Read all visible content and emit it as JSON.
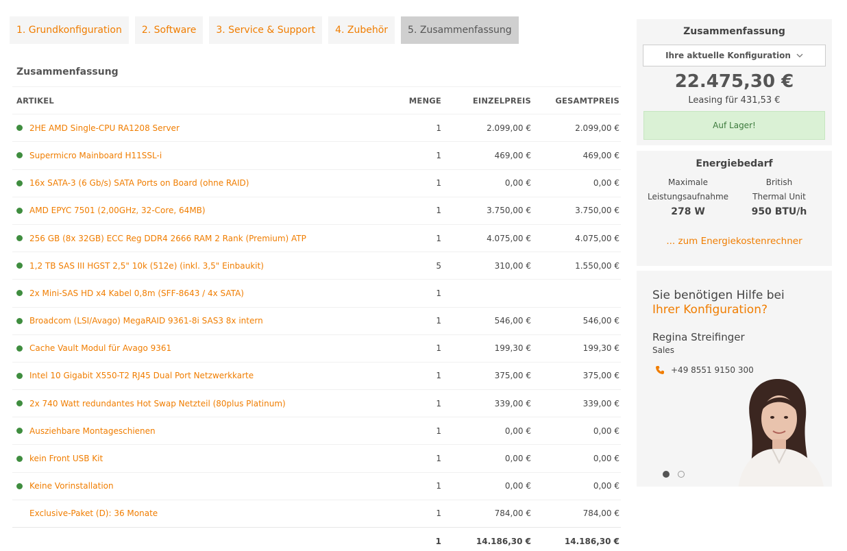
{
  "tabs": [
    {
      "label": "1. Grundkonfiguration"
    },
    {
      "label": "2. Software"
    },
    {
      "label": "3. Service & Support"
    },
    {
      "label": "4. Zubehör"
    },
    {
      "label": "5. Zusammenfassung"
    }
  ],
  "summary_title": "Zusammenfassung",
  "table": {
    "headers": {
      "article": "ARTIKEL",
      "qty": "MENGE",
      "unit": "EINZELPREIS",
      "total": "GESAMTPREIS"
    },
    "rows": [
      {
        "article": "2HE AMD Single-CPU RA1208 Server",
        "qty": "1",
        "unit": "2.099,00 €",
        "total": "2.099,00 €"
      },
      {
        "article": "Supermicro Mainboard H11SSL-i",
        "qty": "1",
        "unit": "469,00 €",
        "total": "469,00 €"
      },
      {
        "article": "16x SATA-3 (6 Gb/s) SATA Ports on Board (ohne RAID)",
        "qty": "1",
        "unit": "0,00 €",
        "total": "0,00 €"
      },
      {
        "article": "AMD EPYC 7501 (2,00GHz, 32-Core, 64MB)",
        "qty": "1",
        "unit": "3.750,00 €",
        "total": "3.750,00 €"
      },
      {
        "article": "256 GB (8x 32GB) ECC Reg DDR4 2666 RAM 2 Rank (Premium) ATP",
        "qty": "1",
        "unit": "4.075,00 €",
        "total": "4.075,00 €"
      },
      {
        "article": "1,2 TB SAS III HGST 2,5\" 10k (512e) (inkl. 3,5\" Einbaukit)",
        "qty": "5",
        "unit": "310,00 €",
        "total": "1.550,00 €"
      },
      {
        "article": "2x Mini-SAS HD x4 Kabel 0,8m (SFF-8643 / 4x SATA)",
        "qty": "1",
        "unit": "",
        "total": ""
      },
      {
        "article": "Broadcom (LSI/Avago) MegaRAID 9361-8i SAS3 8x intern",
        "qty": "1",
        "unit": "546,00 €",
        "total": "546,00 €"
      },
      {
        "article": "Cache Vault Modul für Avago 9361",
        "qty": "1",
        "unit": "199,30 €",
        "total": "199,30 €"
      },
      {
        "article": "Intel 10 Gigabit X550-T2 RJ45 Dual Port Netzwerkkarte",
        "qty": "1",
        "unit": "375,00 €",
        "total": "375,00 €"
      },
      {
        "article": "2x 740 Watt redundantes Hot Swap Netzteil (80plus Platinum)",
        "qty": "1",
        "unit": "339,00 €",
        "total": "339,00 €"
      },
      {
        "article": "Ausziehbare Montageschienen",
        "qty": "1",
        "unit": "0,00 €",
        "total": "0,00 €"
      },
      {
        "article": "kein Front USB Kit",
        "qty": "1",
        "unit": "0,00 €",
        "total": "0,00 €"
      },
      {
        "article": "Keine Vorinstallation",
        "qty": "1",
        "unit": "0,00 €",
        "total": "0,00 €"
      },
      {
        "article": "Exclusive-Paket (D): 36 Monate",
        "qty": "1",
        "unit": "784,00 €",
        "total": "784,00 €"
      }
    ],
    "sum": {
      "qty": "1",
      "unit": "14.186,30 €",
      "total": "14.186,30 €"
    }
  },
  "sidebar": {
    "summary": {
      "title": "Zusammenfassung",
      "select_label": "Ihre aktuelle Konfiguration",
      "price": "22.475,30 €",
      "leasing": "Leasing für 431,53 €",
      "stock": "Auf Lager!"
    },
    "energy": {
      "title": "Energiebedarf",
      "power_label_1": "Maximale",
      "power_label_2": "Leistungsaufnahme",
      "power_value": "278 W",
      "btu_label_1": "British",
      "btu_label_2": "Thermal Unit",
      "btu_value": "950 BTU/h",
      "link": "... zum Energiekostenrechner"
    },
    "help": {
      "line1": "Sie benötigen Hilfe bei",
      "line2": "Ihrer Konfiguration?",
      "name": "Regina Streifinger",
      "role": "Sales",
      "phone": "+49 8551 9150 300"
    }
  },
  "colors": {
    "accent": "#f07d00",
    "stock_bg": "#daf1d5",
    "dot_green": "#3f8d3f",
    "panel_bg": "#f5f5f5"
  }
}
